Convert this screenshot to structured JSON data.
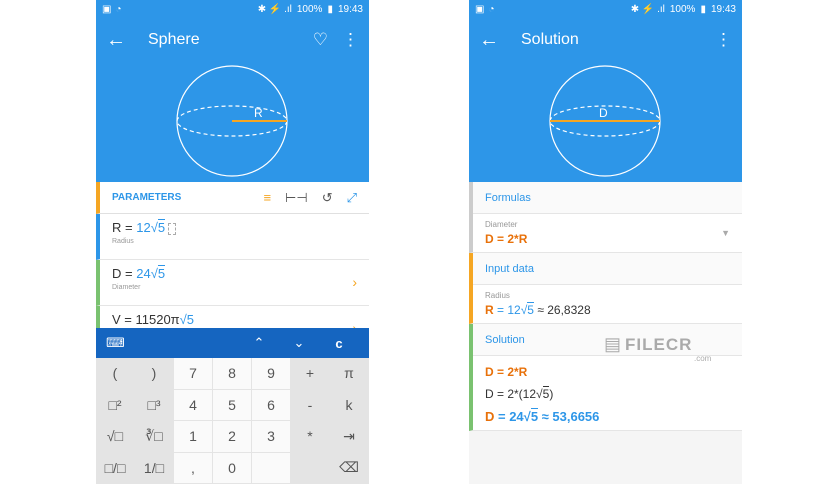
{
  "status_bar": {
    "time": "19:43",
    "battery": "100%"
  },
  "left": {
    "title": "Sphere",
    "hero_label": "R",
    "params_title": "PARAMETERS",
    "rows": [
      {
        "eq": "R = ",
        "coef": "12",
        "rad": "5",
        "sub": "Radius"
      },
      {
        "eq": "D = ",
        "coef": "24",
        "rad": "5",
        "sub": "Diameter",
        "chev": "›"
      },
      {
        "eq": "V = 11520π",
        "coef": "",
        "rad": "5",
        "sub": "",
        "chev": "›"
      }
    ],
    "kbar": {
      "up": "⌃",
      "down": "⌄",
      "clear": "c"
    },
    "keys": [
      "(",
      ")",
      "7",
      "8",
      "9",
      "+",
      "π",
      "□²",
      "□³",
      "4",
      "5",
      "6",
      "-",
      "k",
      "√□",
      "∛□",
      "1",
      "2",
      "3",
      "*",
      "⇥",
      "□/□",
      "1/□",
      ",",
      "0",
      "",
      "",
      "⌫"
    ]
  },
  "right": {
    "title": "Solution",
    "hero_label": "D",
    "formulas": {
      "head": "Formulas",
      "label": "Diameter",
      "lhs": "D",
      "rhs": " = 2*R"
    },
    "input": {
      "head": "Input data",
      "label": "Radius",
      "lhs": "R",
      "mid": " = 12",
      "rad": "5",
      "approx": " ≈ 26,8328"
    },
    "solution": {
      "head": "Solution",
      "l1": "D = 2*R",
      "l2a": "D = 2*(12",
      "l2rad": "5",
      "l2b": ")",
      "l3lhs": "D",
      "l3mid": " = 24",
      "l3rad": "5",
      "l3approx": " ≈ 53,6656"
    }
  },
  "watermark": {
    "name": "FILECR",
    "com": ".com"
  },
  "colors": {
    "primary": "#2d96e8",
    "accent": "#f5a623",
    "green": "#7ac270",
    "orange": "#e8710a"
  }
}
